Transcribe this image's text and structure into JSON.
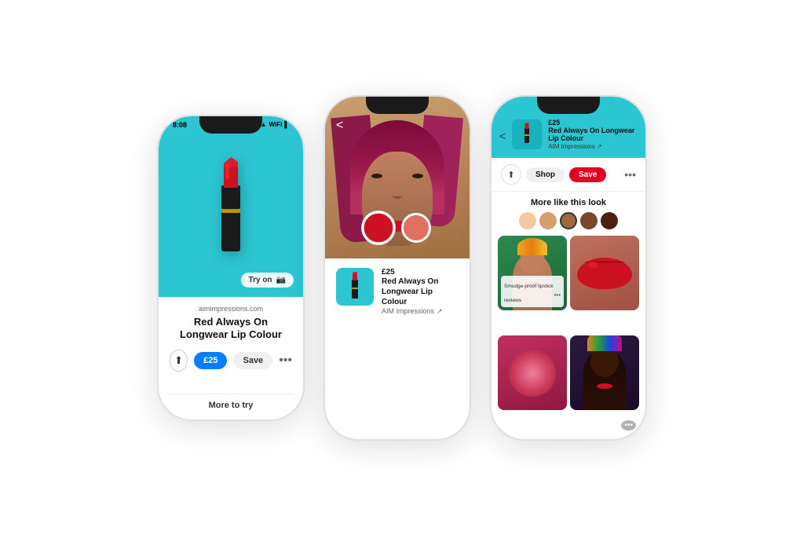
{
  "phones": {
    "phone1": {
      "status_time": "8:08",
      "signal_icons": "▌▌▌ ᅠ WiFi ▲",
      "image_bg_color": "#2cc5d2",
      "try_on_label": "Try on",
      "site_url": "aimimpressions.com",
      "product_title": "Red Always On Longwear\nLip Colour",
      "price": "£25",
      "save_label": "Save",
      "more_to_try": "More to try"
    },
    "phone2": {
      "back_label": "<",
      "product_price": "£25",
      "product_name": "Red Always On Longwear\nLip Colour",
      "product_brand": "AIM Impressions",
      "swatch_colors": [
        "#cc1122",
        "#e86060"
      ],
      "image_bg": "#c9a06e"
    },
    "phone3": {
      "back_label": "<",
      "product_price": "£25",
      "product_name": "Red Always On Longwear Lip Colour",
      "product_brand": "AIM Impressions ↗",
      "shop_label": "Shop",
      "save_label": "Save",
      "more_like_title": "More like this look",
      "color_dots": [
        "#f5c8a0",
        "#d4a070",
        "#a06840",
        "#7a4828",
        "#4a2010"
      ],
      "grid_label": "Smudge-proof lipstick reviews"
    }
  }
}
